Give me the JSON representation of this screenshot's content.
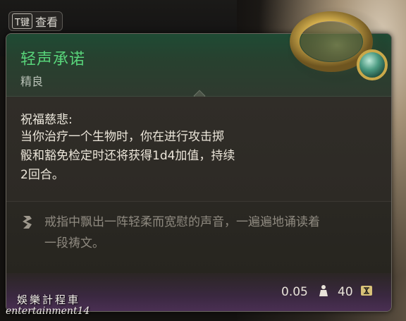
{
  "hint": {
    "key_label": "T键",
    "action_label": "查看"
  },
  "item": {
    "name": "轻声承诺",
    "rarity": "精良",
    "effect_title": "祝福慈悲:",
    "effect_lines": [
      "当你治疗一个生物时，你在进行攻击掷",
      "骰和豁免检定时还将获得1d4加值，持续",
      "2回合。"
    ],
    "flavor_lines": [
      "戒指中飘出一阵轻柔而宽慰的声音，一遍遍地诵读着",
      "一段祷文。"
    ],
    "weight": "0.05",
    "price": "40"
  },
  "watermark": {
    "line1": "娛樂計程車",
    "line2": "entertainment14"
  },
  "icons": {
    "item": "ring-icon",
    "flavor": "quote-icon",
    "weight": "weight-icon",
    "price": "gold-coin-icon"
  },
  "colors": {
    "name": "#58d47a",
    "rarity_header": "#1f4b34",
    "footer": "#4a2f53"
  }
}
